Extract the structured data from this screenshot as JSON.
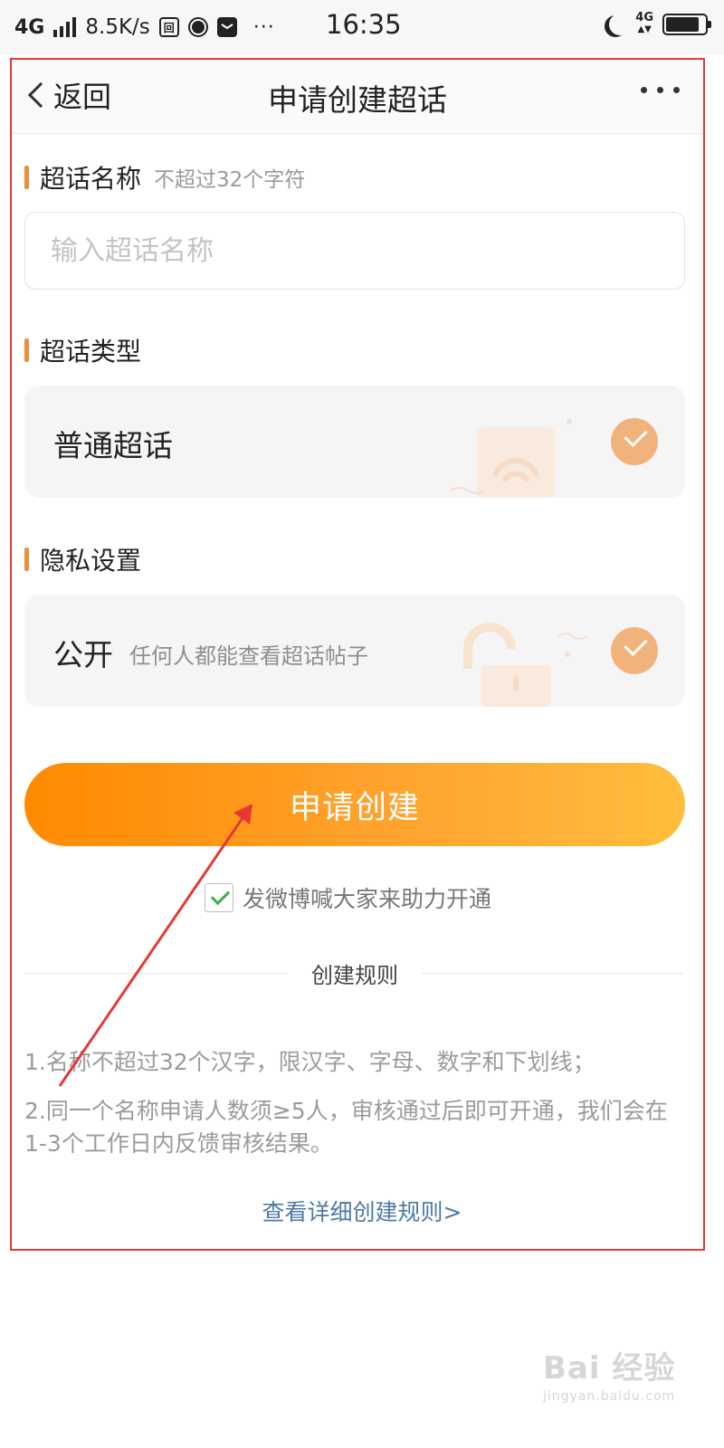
{
  "status_bar": {
    "network": "4G",
    "speed": "8.5K/s",
    "app_icon_1": "回",
    "time": "16:35",
    "right_network": "4G",
    "battery_level": 0.85
  },
  "nav": {
    "back_label": "返回",
    "title": "申请创建超话",
    "more_icon": "more-dots-icon"
  },
  "name_section": {
    "title": "超话名称",
    "hint": "不超过32个字符",
    "input_placeholder": "输入超话名称",
    "input_value": ""
  },
  "type_section": {
    "title": "超话类型",
    "option_label": "普通超话",
    "selected": true
  },
  "privacy_section": {
    "title": "隐私设置",
    "option_label": "公开",
    "option_desc": "任何人都能查看超话帖子",
    "selected": true
  },
  "apply_button": "申请创建",
  "share_option": {
    "label": "发微博喊大家来助力开通",
    "checked": true
  },
  "rules": {
    "title": "创建规则",
    "items": [
      "1.名称不超过32个汉字，限汉字、字母、数字和下划线；",
      "2.同一个名称申请人数须≥5人，审核通过后即可开通，我们会在1-3个工作日内反馈审核结果。"
    ],
    "link": "查看详细创建规则>"
  },
  "watermark": {
    "main": "Bai 经验",
    "sub": "jingyan.baidu.com"
  },
  "colors": {
    "accent_orange": "#ff8a00",
    "check_orange": "#f2b27b",
    "section_bar": "#e8903d",
    "link_blue": "#4e7aa5",
    "annotation_red": "#e53935"
  }
}
